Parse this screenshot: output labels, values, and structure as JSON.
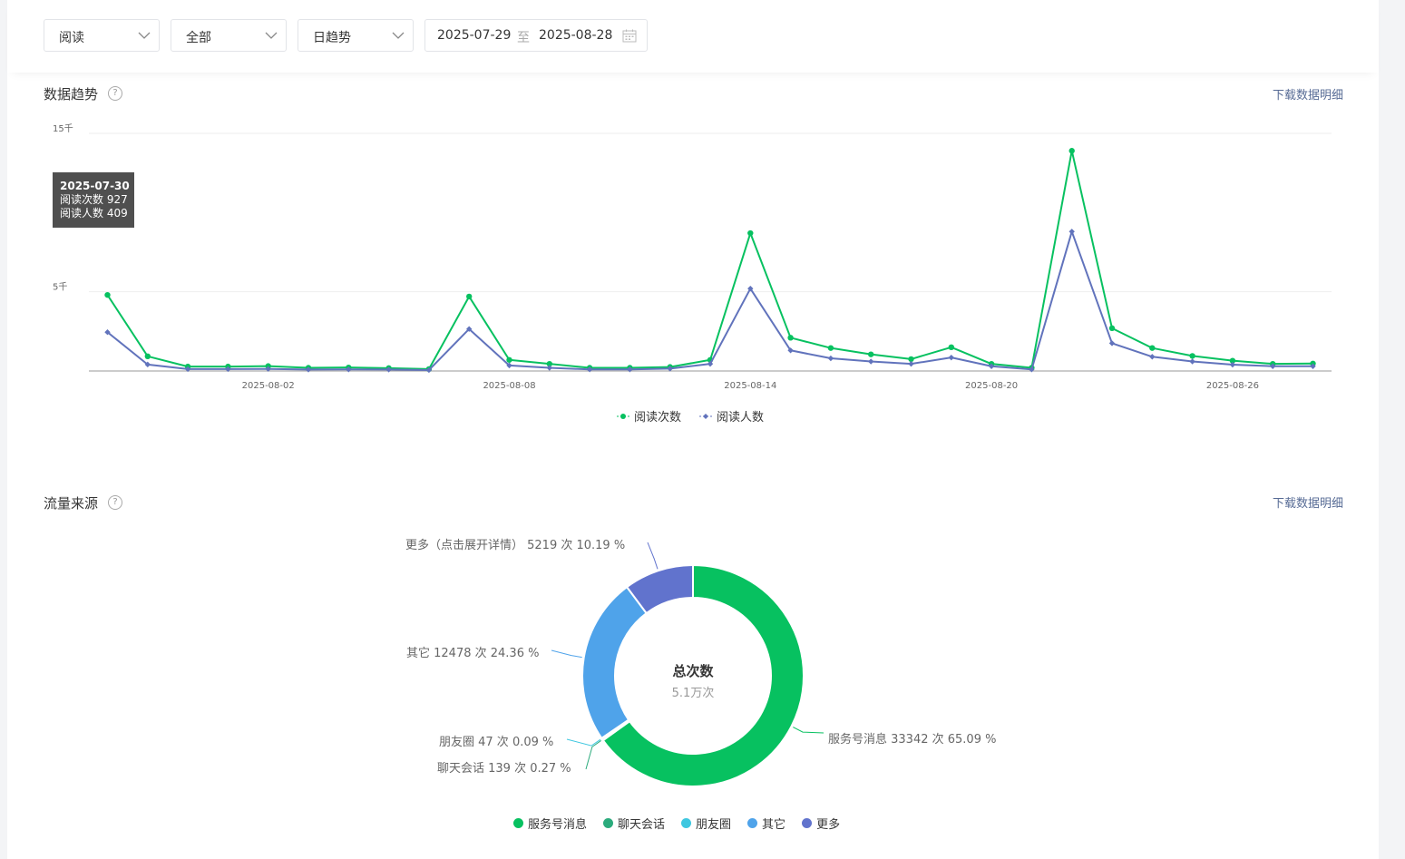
{
  "filters": {
    "metric": "阅读",
    "scope": "全部",
    "granularity": "日趋势",
    "date_start": "2025-07-29",
    "date_sep": "至",
    "date_end": "2025-08-28"
  },
  "trend": {
    "title": "数据趋势",
    "help": "?",
    "download": "下载数据明细",
    "tooltip": {
      "date": "2025-07-30",
      "line1": "阅读次数 927",
      "line2": "阅读人数 409"
    },
    "legend": [
      {
        "name": "阅读次数",
        "color": "#07c160"
      },
      {
        "name": "阅读人数",
        "color": "#6173bc"
      }
    ]
  },
  "source": {
    "title": "流量来源",
    "help": "?",
    "download": "下载数据明细",
    "center_title": "总次数",
    "center_sub": "5.1万次",
    "labels": {
      "more": "更多（点击展开详情） 5219 次 10.19 %",
      "other": "其它 12478 次 24.36 %",
      "moments": "朋友圈 47 次 0.09 %",
      "chat": "聊天会话 139 次 0.27 %",
      "service": "服务号消息 33342 次 65.09 %"
    },
    "legend": [
      {
        "name": "服务号消息",
        "color": "#07c160"
      },
      {
        "name": "聊天会话",
        "color": "#2bab7c"
      },
      {
        "name": "朋友圈",
        "color": "#3ec7e0"
      },
      {
        "name": "其它",
        "color": "#4fa3ea"
      },
      {
        "name": "更多",
        "color": "#6173cd"
      }
    ]
  },
  "chart_data": [
    {
      "type": "line",
      "title": "数据趋势",
      "x": [
        "2025-07-29",
        "2025-07-30",
        "2025-07-31",
        "2025-08-01",
        "2025-08-02",
        "2025-08-03",
        "2025-08-04",
        "2025-08-05",
        "2025-08-06",
        "2025-08-07",
        "2025-08-08",
        "2025-08-09",
        "2025-08-10",
        "2025-08-11",
        "2025-08-12",
        "2025-08-13",
        "2025-08-14",
        "2025-08-15",
        "2025-08-16",
        "2025-08-17",
        "2025-08-18",
        "2025-08-19",
        "2025-08-20",
        "2025-08-21",
        "2025-08-22",
        "2025-08-23",
        "2025-08-24",
        "2025-08-25",
        "2025-08-26",
        "2025-08-27",
        "2025-08-28"
      ],
      "x_ticks": [
        "2025-08-02",
        "2025-08-08",
        "2025-08-14",
        "2025-08-20",
        "2025-08-26"
      ],
      "y_ticks": [
        "5千",
        "15千"
      ],
      "y_tick_values": [
        5000,
        15000
      ],
      "ylim": [
        0,
        15000
      ],
      "grid": true,
      "legend_position": "bottom-center",
      "series": [
        {
          "name": "阅读次数",
          "color": "#07c160",
          "marker": "circle",
          "values": [
            4800,
            927,
            280,
            280,
            310,
            200,
            220,
            180,
            120,
            4700,
            700,
            450,
            200,
            200,
            250,
            700,
            8700,
            2100,
            1450,
            1050,
            750,
            1500,
            450,
            200,
            13900,
            2700,
            1450,
            950,
            650,
            450,
            470
          ]
        },
        {
          "name": "阅读人数",
          "color": "#6173bc",
          "marker": "diamond",
          "values": [
            2450,
            409,
            120,
            120,
            130,
            90,
            100,
            90,
            60,
            2650,
            350,
            200,
            100,
            100,
            150,
            450,
            5200,
            1300,
            800,
            600,
            450,
            850,
            300,
            100,
            8800,
            1750,
            900,
            600,
            400,
            300,
            300
          ]
        }
      ]
    },
    {
      "type": "pie",
      "title": "流量来源",
      "categories": [
        "服务号消息",
        "聊天会话",
        "朋友圈",
        "其它",
        "更多"
      ],
      "values": [
        33342,
        139,
        47,
        12478,
        5219
      ],
      "percent": [
        65.09,
        0.27,
        0.09,
        24.36,
        10.19
      ],
      "colors": [
        "#07c160",
        "#2bab7c",
        "#3ec7e0",
        "#4fa3ea",
        "#6173cd"
      ],
      "legend_position": "bottom-center"
    }
  ]
}
